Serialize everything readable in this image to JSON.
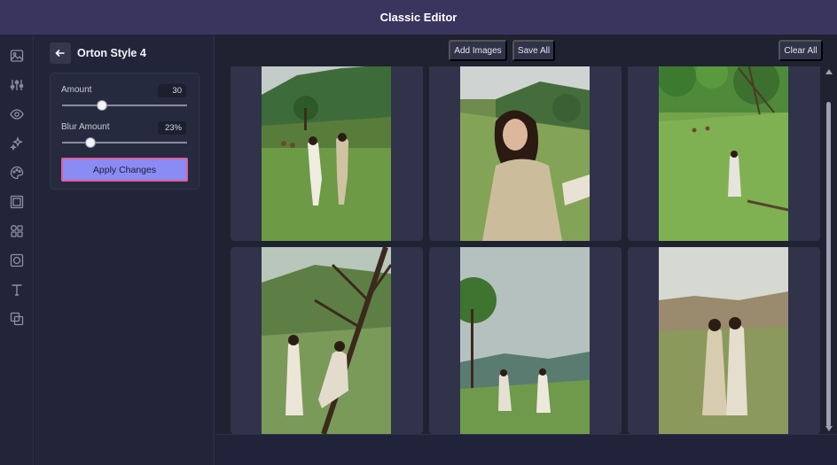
{
  "app": {
    "title": "Classic Editor"
  },
  "rail": {
    "icons": [
      "image-icon",
      "sliders-icon",
      "eye-icon",
      "sparkle-icon",
      "palette-icon",
      "frame-icon",
      "shapes-icon",
      "overlay-icon",
      "text-icon",
      "layers-icon"
    ]
  },
  "panel": {
    "title": "Orton Style 4",
    "amount": {
      "label": "Amount",
      "value": "30",
      "fraction": 0.32
    },
    "blur": {
      "label": "Blur Amount",
      "value": "23%",
      "fraction": 0.23
    },
    "apply_label": "Apply Changes"
  },
  "toolbar": {
    "add_images": "Add Images",
    "save_all": "Save All",
    "clear_all": "Clear All"
  },
  "colors": {
    "titlebar": "#3a355f",
    "panel": "#22253a",
    "accent": "#8b8bf5",
    "highlight": "#e35d98"
  },
  "gallery": {
    "photos": [
      "couple-walking-photo",
      "woman-portrait-photo",
      "woman-meadow-photo",
      "couple-tree-photo",
      "couple-holding-hands-photo",
      "couple-embrace-photo"
    ]
  }
}
